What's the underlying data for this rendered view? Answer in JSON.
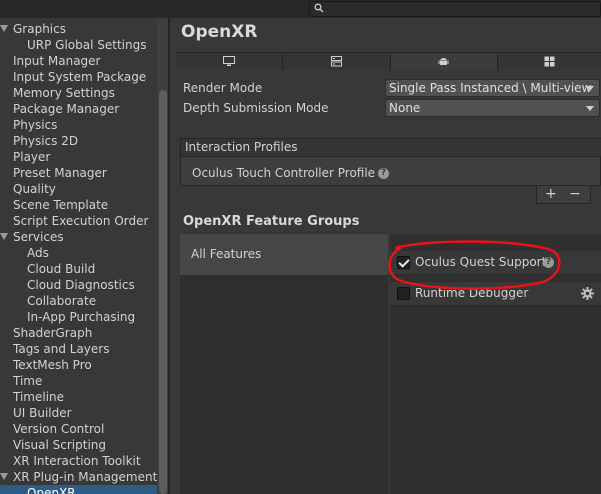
{
  "search": {
    "placeholder": ""
  },
  "sidebar": {
    "items": [
      {
        "label": "Graphics",
        "indent": 0,
        "expandable": true
      },
      {
        "label": "URP Global Settings",
        "indent": 1
      },
      {
        "label": "Input Manager",
        "indent": 0
      },
      {
        "label": "Input System Package",
        "indent": 0
      },
      {
        "label": "Memory Settings",
        "indent": 0
      },
      {
        "label": "Package Manager",
        "indent": 0
      },
      {
        "label": "Physics",
        "indent": 0
      },
      {
        "label": "Physics 2D",
        "indent": 0
      },
      {
        "label": "Player",
        "indent": 0
      },
      {
        "label": "Preset Manager",
        "indent": 0
      },
      {
        "label": "Quality",
        "indent": 0
      },
      {
        "label": "Scene Template",
        "indent": 0
      },
      {
        "label": "Script Execution Order",
        "indent": 0
      },
      {
        "label": "Services",
        "indent": 0,
        "expandable": true
      },
      {
        "label": "Ads",
        "indent": 1
      },
      {
        "label": "Cloud Build",
        "indent": 1
      },
      {
        "label": "Cloud Diagnostics",
        "indent": 1
      },
      {
        "label": "Collaborate",
        "indent": 1
      },
      {
        "label": "In-App Purchasing",
        "indent": 1
      },
      {
        "label": "ShaderGraph",
        "indent": 0
      },
      {
        "label": "Tags and Layers",
        "indent": 0
      },
      {
        "label": "TextMesh Pro",
        "indent": 0
      },
      {
        "label": "Time",
        "indent": 0
      },
      {
        "label": "Timeline",
        "indent": 0
      },
      {
        "label": "UI Builder",
        "indent": 0
      },
      {
        "label": "Version Control",
        "indent": 0
      },
      {
        "label": "Visual Scripting",
        "indent": 0
      },
      {
        "label": "XR Interaction Toolkit",
        "indent": 0
      },
      {
        "label": "XR Plug-in Management",
        "indent": 0,
        "expandable": true
      },
      {
        "label": "OpenXR",
        "indent": 1,
        "selected": true
      }
    ]
  },
  "main": {
    "title": "OpenXR",
    "tabs": [
      {
        "icon": "desktop-icon"
      },
      {
        "icon": "server-icon"
      },
      {
        "icon": "android-icon",
        "active": true
      },
      {
        "icon": "windows-icon"
      }
    ],
    "render_mode": {
      "label": "Render Mode",
      "value": "Single Pass Instanced \\ Multi-view"
    },
    "depth_mode": {
      "label": "Depth Submission Mode",
      "value": "None"
    },
    "interaction_profiles": {
      "header": "Interaction Profiles",
      "items": [
        "Oculus Touch Controller Profile"
      ],
      "add_label": "+",
      "remove_label": "−"
    },
    "feature_groups": {
      "title": "OpenXR Feature Groups",
      "groups": [
        "All Features"
      ],
      "features": [
        {
          "label": "Oculus Quest Support",
          "checked": true,
          "help": true
        },
        {
          "label": "Runtime Debugger",
          "checked": false,
          "gear": true
        }
      ]
    }
  },
  "colors": {
    "selection": "#2c5d87",
    "annotation_ring": "#e8121a"
  }
}
